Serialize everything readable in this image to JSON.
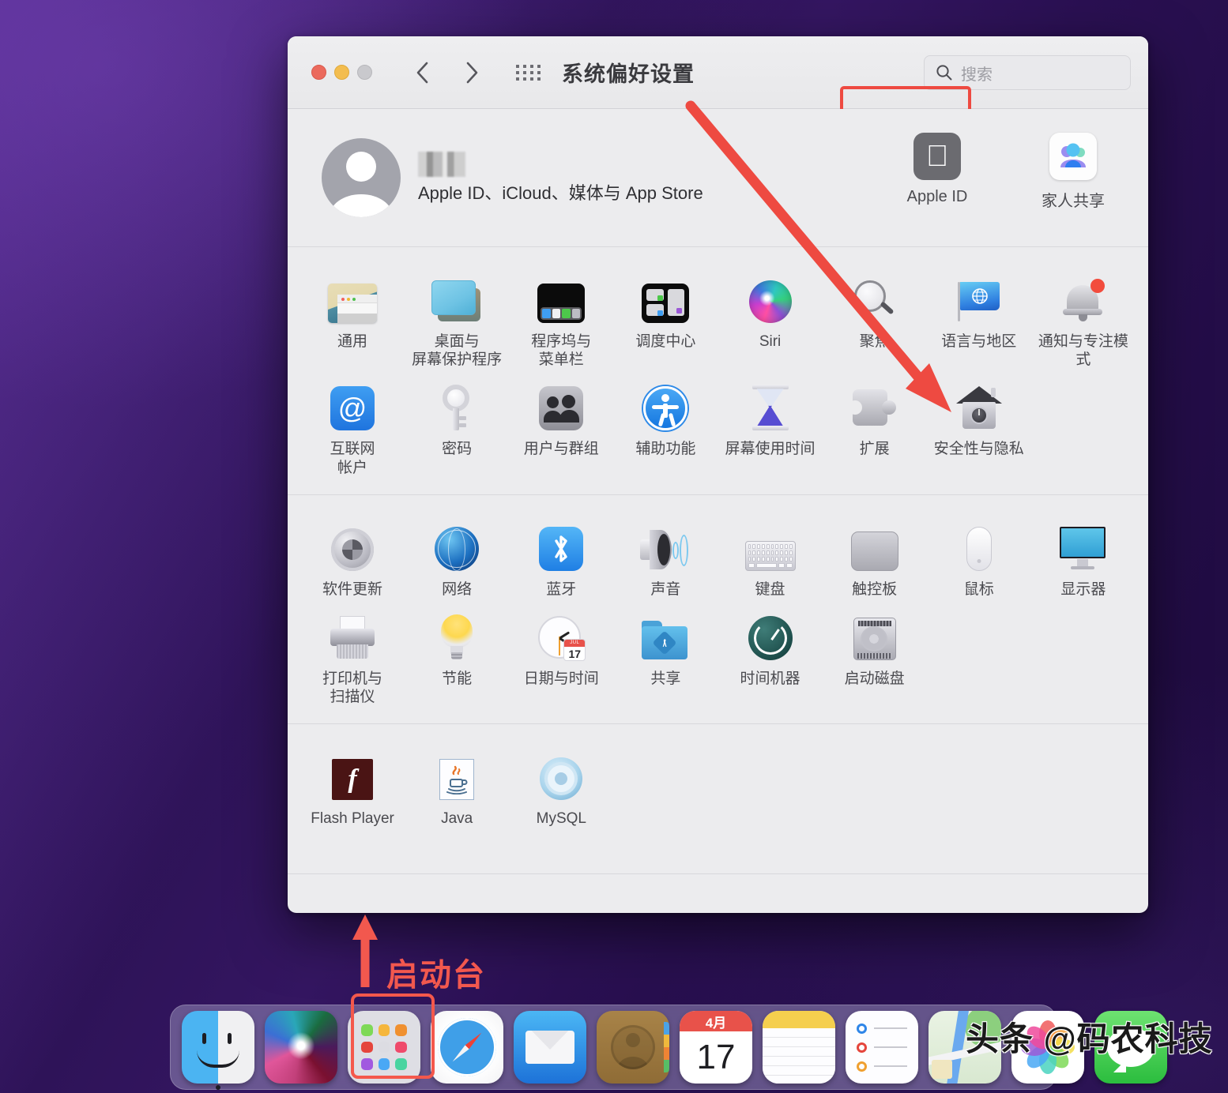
{
  "window": {
    "title": "系统偏好设置",
    "traffic_lights": [
      "close",
      "minimize",
      "zoom"
    ],
    "search": {
      "placeholder": "搜索"
    },
    "nav": {
      "back": "‹",
      "forward": "›"
    }
  },
  "apple_id": {
    "name_redacted": "",
    "subtitle": "Apple ID、iCloud、媒体与 App Store",
    "shortcuts": [
      {
        "label": "Apple ID",
        "icon": "apple-id-icon"
      },
      {
        "label": "家人共享",
        "icon": "family-sharing-icon"
      }
    ]
  },
  "sections": [
    {
      "name": "personal",
      "panes": [
        {
          "label": "通用",
          "icon": "general-icon"
        },
        {
          "label": "桌面与\n屏幕保护程序",
          "icon": "desktop-screensaver-icon"
        },
        {
          "label": "程序坞与\n菜单栏",
          "icon": "dock-menubar-icon"
        },
        {
          "label": "调度中心",
          "icon": "mission-control-icon"
        },
        {
          "label": "Siri",
          "icon": "siri-icon"
        },
        {
          "label": "聚焦",
          "icon": "spotlight-icon"
        },
        {
          "label": "语言与地区",
          "icon": "language-region-icon"
        },
        {
          "label": "通知与专注模式",
          "icon": "notifications-focus-icon"
        },
        {
          "label": "互联网\n帐户",
          "icon": "internet-accounts-icon"
        },
        {
          "label": "密码",
          "icon": "passwords-key-icon"
        },
        {
          "label": "用户与群组",
          "icon": "users-groups-icon"
        },
        {
          "label": "辅助功能",
          "icon": "accessibility-icon"
        },
        {
          "label": "屏幕使用时间",
          "icon": "screen-time-icon"
        },
        {
          "label": "扩展",
          "icon": "extensions-puzzle-icon"
        },
        {
          "label": "安全性与隐私",
          "icon": "security-privacy-icon"
        }
      ]
    },
    {
      "name": "hardware",
      "panes": [
        {
          "label": "软件更新",
          "icon": "software-update-icon"
        },
        {
          "label": "网络",
          "icon": "network-globe-icon"
        },
        {
          "label": "蓝牙",
          "icon": "bluetooth-icon"
        },
        {
          "label": "声音",
          "icon": "sound-speaker-icon"
        },
        {
          "label": "键盘",
          "icon": "keyboard-icon"
        },
        {
          "label": "触控板",
          "icon": "trackpad-icon"
        },
        {
          "label": "鼠标",
          "icon": "mouse-icon"
        },
        {
          "label": "显示器",
          "icon": "displays-icon"
        },
        {
          "label": "打印机与\n扫描仪",
          "icon": "printers-scanners-icon"
        },
        {
          "label": "节能",
          "icon": "energy-saver-bulb-icon"
        },
        {
          "label": "日期与时间",
          "icon": "date-time-clock-icon"
        },
        {
          "label": "共享",
          "icon": "sharing-folder-icon"
        },
        {
          "label": "时间机器",
          "icon": "time-machine-icon"
        },
        {
          "label": "启动磁盘",
          "icon": "startup-disk-icon"
        }
      ]
    },
    {
      "name": "third-party",
      "panes": [
        {
          "label": "Flash Player",
          "icon": "flash-player-icon"
        },
        {
          "label": "Java",
          "icon": "java-icon"
        },
        {
          "label": "MySQL",
          "icon": "mysql-icon"
        }
      ]
    }
  ],
  "date_time_icon": {
    "month": "JUL",
    "day": "17"
  },
  "annotations": {
    "title_box_color": "#ee4a41",
    "security_box_color": "#ee4a41",
    "arrow_color": "#ee4a41",
    "launchpad_label": "启动台",
    "launchpad_label_color": "#f2584e",
    "dock_box_color": "#f4584c"
  },
  "dock": {
    "items": [
      {
        "label": "访达",
        "icon": "finder-icon",
        "running": true
      },
      {
        "label": "Siri",
        "icon": "siri-dock-icon",
        "running": false
      },
      {
        "label": "启动台",
        "icon": "launchpad-icon",
        "running": false
      },
      {
        "label": "Safari 浏览器",
        "icon": "safari-icon",
        "running": false
      },
      {
        "label": "邮件",
        "icon": "mail-icon",
        "running": false
      },
      {
        "label": "通讯录",
        "icon": "contacts-icon",
        "running": false
      },
      {
        "label": "日历",
        "icon": "calendar-icon",
        "running": false
      },
      {
        "label": "备忘录",
        "icon": "notes-icon",
        "running": false
      },
      {
        "label": "提醒事项",
        "icon": "reminders-icon",
        "running": false
      },
      {
        "label": "地图",
        "icon": "maps-icon",
        "running": false
      },
      {
        "label": "照片",
        "icon": "photos-icon",
        "running": false
      },
      {
        "label": "信息",
        "icon": "messages-icon",
        "running": false
      }
    ],
    "calendar": {
      "month": "4月",
      "day": "17"
    }
  },
  "watermark": {
    "text": "头条 @码农科技"
  }
}
